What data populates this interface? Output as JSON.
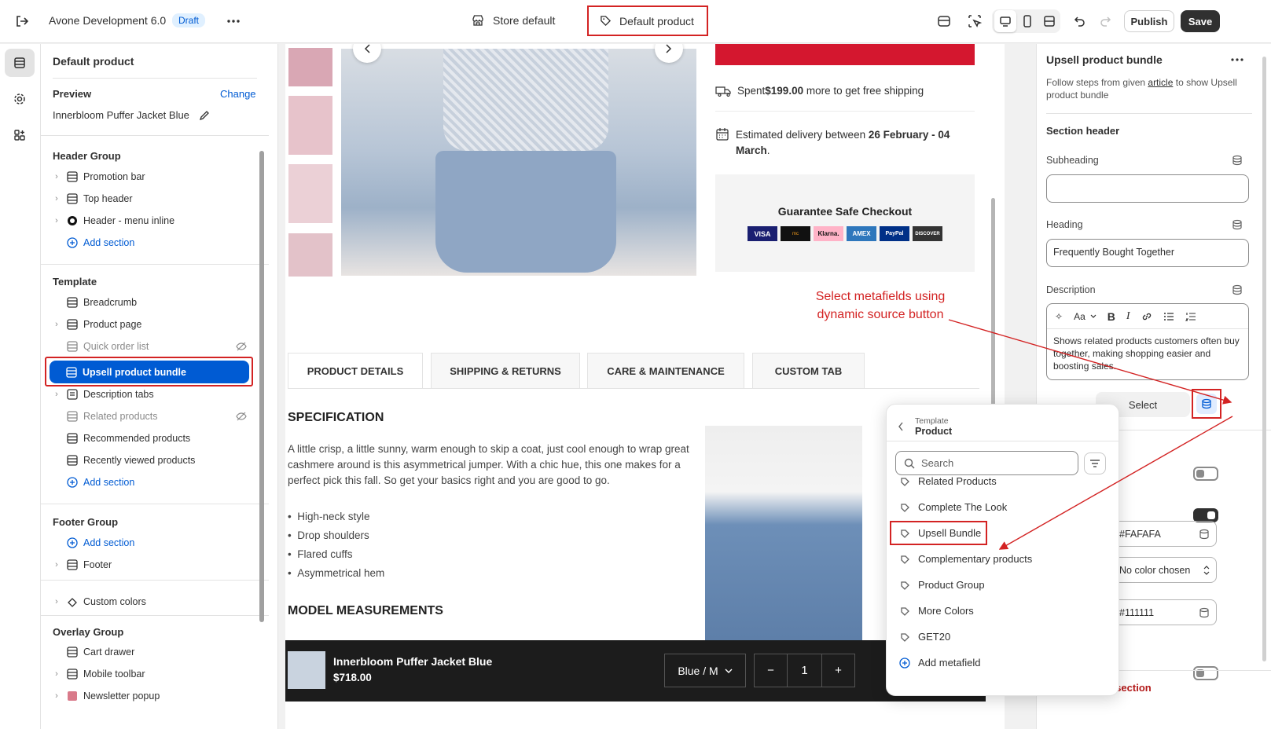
{
  "topbar": {
    "store_name": "Avone Development 6.0",
    "status_badge": "Draft",
    "store_default": "Store default",
    "template": "Default product",
    "publish": "Publish",
    "save": "Save"
  },
  "sidebar": {
    "title": "Default product",
    "preview_label": "Preview",
    "change_link": "Change",
    "preview_product": "Innerbloom Puffer Jacket Blue",
    "header_group": {
      "title": "Header Group",
      "items": [
        "Promotion bar",
        "Top header",
        "Header - menu inline"
      ],
      "add": "Add section"
    },
    "template": {
      "title": "Template",
      "items": [
        "Breadcrumb",
        "Product page",
        "Quick order list",
        "Upsell product bundle",
        "Description tabs",
        "Related products",
        "Recommended products",
        "Recently viewed products"
      ],
      "add": "Add section"
    },
    "footer_group": {
      "title": "Footer Group",
      "add": "Add section",
      "items": [
        "Footer"
      ]
    },
    "custom_colors": "Custom colors",
    "overlay_group": {
      "title": "Overlay Group",
      "items": [
        "Cart drawer",
        "Mobile toolbar",
        "Newsletter popup"
      ]
    }
  },
  "preview": {
    "shipping_prefix": "Spent ",
    "shipping_amount": "$199.00",
    "shipping_suffix": " more to get free shipping",
    "delivery_prefix": "Estimated delivery between ",
    "delivery_dates_1": "26 February - 04",
    "delivery_dates_2": "March",
    "delivery_end": ".",
    "guarantee_title": "Guarantee Safe Checkout",
    "payments": [
      "VISA",
      "mc",
      "Klarna.",
      "AMEX",
      "PayPal",
      "DISCOVER"
    ],
    "tabs": [
      "PRODUCT DETAILS",
      "SHIPPING & RETURNS",
      "CARE & MAINTENANCE",
      "CUSTOM TAB"
    ],
    "specification_title": "SPECIFICATION",
    "specification_text": "A little crisp, a little sunny, warm enough to skip a coat, just cool enough to wrap great cashmere around is this asymmetrical jumper. With a chic hue, this one makes for a perfect pick this fall. So get your basics right and you are good to go.",
    "bullets": [
      "High-neck style",
      "Drop shoulders",
      "Flared cuffs",
      "Asymmetrical hem"
    ],
    "measurements_title": "MODEL MEASUREMENTS",
    "sticky": {
      "product_name": "Innerbloom Puffer Jacket Blue",
      "price": "$718.00",
      "variant": "Blue / M",
      "quantity": "1",
      "minus": "−",
      "plus": "+"
    }
  },
  "annotation": {
    "line1": "Select metafields using",
    "line2": "dynamic source button"
  },
  "rpanel": {
    "title": "Upsell product bundle",
    "help_prefix": "Follow steps from given ",
    "help_link": "article",
    "help_suffix": " to show Upsell product bundle",
    "section_header": "Section header",
    "subheading_label": "Subheading",
    "subheading_value": "",
    "heading_label": "Heading",
    "heading_value": "Frequently Bought Together",
    "description_label": "Description",
    "description_value": "Shows related products customers often buy together, making shopping easier and boosting sales.",
    "select_button": "Select",
    "color1": "#FAFAFA",
    "color2": "No color chosen",
    "color3": "#111111",
    "remove_section": "Remove section"
  },
  "popover": {
    "breadcrumb_parent": "Template",
    "breadcrumb_current": "Product",
    "search_placeholder": "Search",
    "items": [
      "Related Products",
      "Complete The Look",
      "Upsell Bundle",
      "Complementary products",
      "Product Group",
      "More Colors",
      "GET20"
    ],
    "add_metafield": "Add metafield"
  }
}
